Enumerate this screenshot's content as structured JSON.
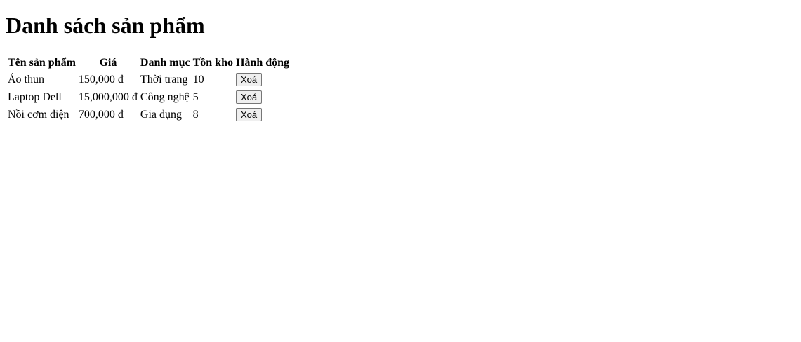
{
  "page": {
    "title": "Danh sách sản phẩm"
  },
  "table": {
    "headers": [
      "Tên sản phẩm",
      "Giá",
      "Danh mục",
      "Tồn kho",
      "Hành động"
    ],
    "rows": [
      {
        "name": "Áo thun",
        "price": "150,000 đ",
        "category": "Thời trang",
        "stock": "10",
        "action": "Xoá"
      },
      {
        "name": "Laptop Dell",
        "price": "15,000,000 đ",
        "category": "Công nghệ",
        "stock": "5",
        "action": "Xoá"
      },
      {
        "name": "Nồi cơm điện",
        "price": "700,000 đ",
        "category": "Gia dụng",
        "stock": "8",
        "action": "Xoá"
      }
    ]
  }
}
